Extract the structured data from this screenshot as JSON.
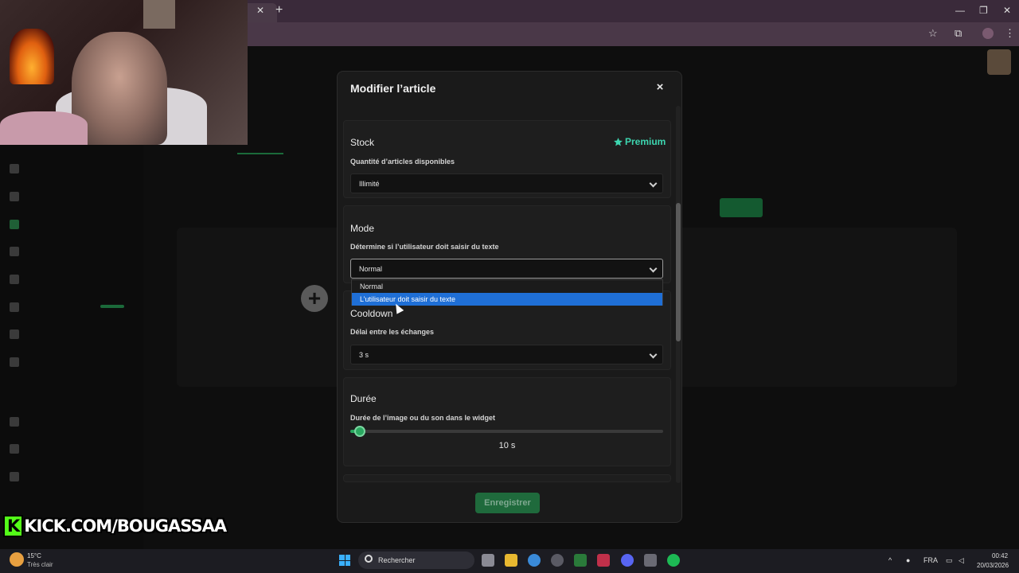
{
  "browser": {
    "tab_close": "✕",
    "new_tab": "+",
    "window_controls": [
      "—",
      "❐",
      "✕"
    ],
    "toolbar_icons": [
      "star-icon",
      "extensions-icon",
      "profile-icon",
      "menu-icon"
    ]
  },
  "modal": {
    "title": "Modifier l’article",
    "close_label": "×",
    "stock": {
      "title": "Stock",
      "premium_label": "Premium",
      "subtitle": "Quantité d’articles disponibles",
      "value": "Illimité"
    },
    "mode": {
      "title": "Mode",
      "subtitle": "Détermine si l’utilisateur doit saisir du texte",
      "value": "Normal",
      "options": [
        "Normal",
        "L’utilisateur doit saisir du texte"
      ],
      "highlighted_option": 1
    },
    "cooldown": {
      "title": "Cooldown",
      "subtitle": "Délai entre les échanges",
      "value": "3 s"
    },
    "duree": {
      "title": "Durée",
      "subtitle": "Durée de l’image ou du son dans le widget",
      "value_label": "10 s",
      "slider_fraction": 0.03
    },
    "save_label": "Enregistrer"
  },
  "overlay": {
    "kick_k": "K",
    "kick_text": "KICK.COM/BOUGASSAA"
  },
  "taskbar": {
    "weather_temp": "15°C",
    "weather_desc": "Très clair",
    "search_placeholder": "Rechercher",
    "language": "FRA",
    "time": "00:42",
    "date": "20/03/2026"
  },
  "colors": {
    "accent_green": "#2aa860",
    "premium_teal": "#3dd6b0",
    "highlight_blue": "#1f6fd6"
  }
}
